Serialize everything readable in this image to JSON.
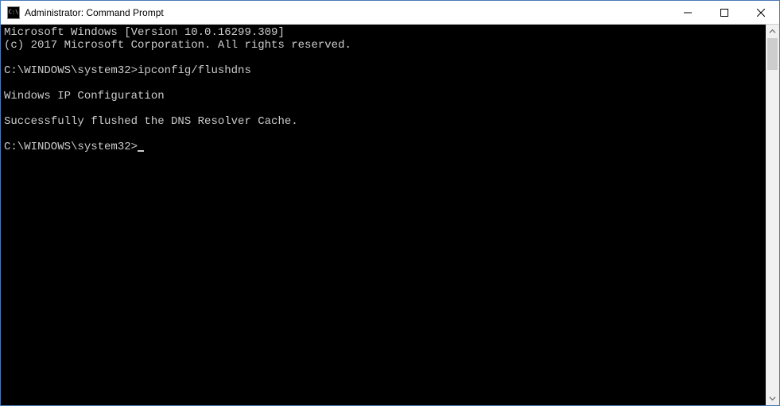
{
  "window": {
    "title": "Administrator: Command Prompt",
    "icon_name": "cmd-icon"
  },
  "console": {
    "lines": [
      "Microsoft Windows [Version 10.0.16299.309]",
      "(c) 2017 Microsoft Corporation. All rights reserved."
    ],
    "prompt1_path": "C:\\WINDOWS\\system32>",
    "prompt1_cmd": "ipconfig/flushdns",
    "heading": "Windows IP Configuration",
    "result": "Successfully flushed the DNS Resolver Cache.",
    "prompt2_path": "C:\\WINDOWS\\system32>"
  }
}
